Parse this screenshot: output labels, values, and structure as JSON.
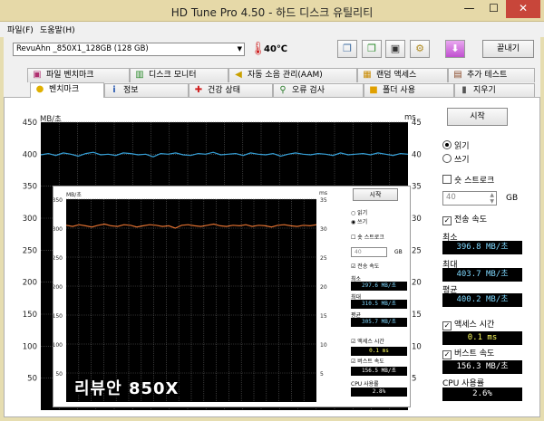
{
  "window": {
    "title": "HD Tune Pro 4.50 - 하드 디스크 유틸리티",
    "minimize": "—",
    "maximize": "☐",
    "close": "✕"
  },
  "menu": [
    "파일(F)",
    "도움말(H)"
  ],
  "toolbar": {
    "drive": "RevuAhn _850X1_128GB (128 GB)",
    "temperature": "40℃",
    "exit": "끝내기"
  },
  "tabs_top": [
    {
      "label": "파일 벤치마크",
      "icon": "file-benchmark-icon",
      "glyph": "▣",
      "color": "#b03070"
    },
    {
      "label": "디스크 모니터",
      "icon": "disk-monitor-icon",
      "glyph": "▥",
      "color": "#2a8a2a"
    },
    {
      "label": "자동 소음 관리(AAM)",
      "icon": "speaker-icon",
      "glyph": "◀",
      "color": "#c9a000"
    },
    {
      "label": "랜덤 액세스",
      "icon": "random-access-icon",
      "glyph": "▦",
      "color": "#c98a00"
    },
    {
      "label": "추가 테스트",
      "icon": "extra-test-icon",
      "glyph": "▤",
      "color": "#8a4a2a"
    }
  ],
  "tabs_bottom": [
    {
      "label": "벤치마크",
      "icon": "benchmark-icon",
      "glyph": "●",
      "color": "#e0b000"
    },
    {
      "label": "정보",
      "icon": "info-icon",
      "glyph": "i",
      "color": "#2a5ab0"
    },
    {
      "label": "건강 상태",
      "icon": "health-icon",
      "glyph": "✚",
      "color": "#d02020"
    },
    {
      "label": "오류 검사",
      "icon": "error-scan-icon",
      "glyph": "⚲",
      "color": "#2a7a2a"
    },
    {
      "label": "폴더 사용",
      "icon": "folder-icon",
      "glyph": "■",
      "color": "#e0a000"
    },
    {
      "label": "지우기",
      "icon": "erase-icon",
      "glyph": "▮",
      "color": "#555555"
    }
  ],
  "chart_data": {
    "type": "line",
    "ylabel_left": "MB/초",
    "ylabel_right": "ms",
    "yticks_left": [
      450,
      400,
      350,
      300,
      250,
      200,
      150,
      100,
      50
    ],
    "yticks_right": [
      45,
      40,
      35,
      30,
      25,
      20,
      15,
      10,
      5
    ],
    "ylim": [
      0,
      450
    ],
    "series": [
      {
        "values": [
          399,
          401,
          398,
          402,
          400,
          397,
          401,
          403,
          399,
          400,
          398,
          402,
          401,
          399,
          400,
          396,
          401,
          400,
          402,
          399,
          398,
          401,
          400,
          403,
          399,
          400,
          401,
          398,
          402,
          400,
          399,
          401,
          397,
          400,
          402,
          400,
          399,
          401,
          400,
          398,
          402,
          399,
          400,
          401,
          399,
          402,
          400,
          398,
          401,
          400
        ]
      }
    ]
  },
  "side": {
    "start": "시작",
    "read": "읽기",
    "write": "쓰기",
    "short_stroke": "숏 스트로크",
    "stroke_value": "40",
    "stroke_unit": "GB",
    "transfer_rate": "전송 속도",
    "min_label": "최소",
    "min_value": "396.8 MB/초",
    "max_label": "최대",
    "max_value": "403.7 MB/초",
    "avg_label": "평균",
    "avg_value": "400.2 MB/초",
    "access_time": "액세스 시간",
    "access_value": "0.1 ms",
    "burst_rate": "버스트 속도",
    "burst_value": "156.3 MB/초",
    "cpu_label": "CPU 사용률",
    "cpu_value": "2.6%"
  },
  "inset": {
    "ylabel_left": "MB/초",
    "ylabel_right": "ms",
    "yticks_left": [
      350,
      300,
      250,
      200,
      150,
      100,
      50
    ],
    "yticks_right": [
      35,
      30,
      25,
      20,
      15,
      10,
      5
    ],
    "chart_data": {
      "type": "line",
      "ylim": [
        0,
        350
      ],
      "series": [
        {
          "values": [
            305,
            303,
            306,
            304,
            302,
            305,
            307,
            304,
            303,
            306,
            305,
            302,
            304,
            306,
            305,
            303,
            304,
            300,
            305,
            306,
            304,
            303,
            305,
            307,
            304,
            303,
            305,
            304,
            306,
            303,
            305,
            304,
            302,
            305,
            306,
            304,
            303,
            305,
            304,
            306
          ]
        }
      ]
    },
    "start": "시작",
    "read": "읽기",
    "write": "쓰기",
    "short_stroke": "숏 스트로크",
    "stroke_value": "40",
    "stroke_unit": "GB",
    "transfer_rate": "전송 속도",
    "min_label": "최소",
    "min_value": "297.6 MB/초",
    "max_label": "최대",
    "max_value": "310.5 MB/초",
    "avg_label": "평균",
    "avg_value": "305.7 MB/초",
    "access_time": "액세스 시간",
    "access_value": "0.1 ms",
    "burst_rate": "버스트 속도",
    "burst_value": "156.5 MB/초",
    "cpu_label": "CPU 사용률",
    "cpu_value": "2.8%"
  },
  "watermark": "리뷰안 850X",
  "colors": {
    "read_line": "#35a0d8",
    "write_line": "#e07030",
    "grid": "#5a5a5a",
    "plot_bg": "#000000",
    "value_box": "#000000",
    "value_text_blue": "#7fd8ff",
    "value_text_yellow": "#ffff60"
  }
}
